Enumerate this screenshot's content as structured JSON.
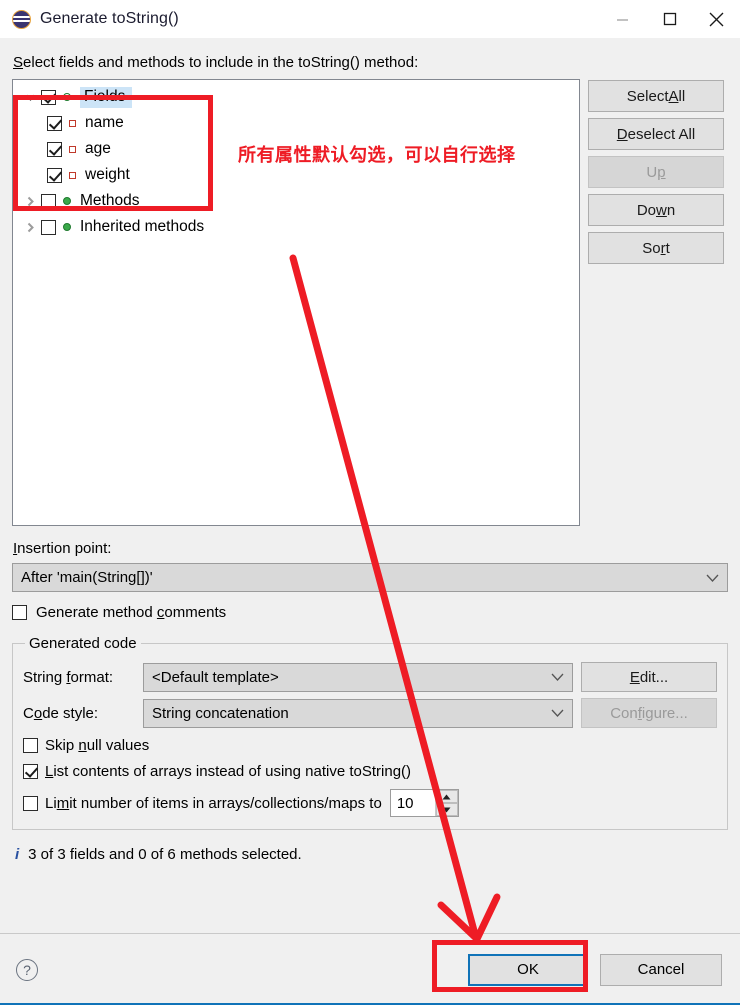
{
  "window": {
    "title": "Generate toString()",
    "icon": "eclipse-java-icon",
    "controls": {
      "minimize": "minimize-icon",
      "maximize": "maximize-icon",
      "close": "close-icon"
    }
  },
  "header": {
    "instruction_prefix": "S",
    "instruction": "elect fields and methods to include in the toString() method:"
  },
  "tree": {
    "nodes": [
      {
        "label": "Fields",
        "checked": true,
        "expanded": true,
        "selected": true,
        "icon": "green-circle-icon",
        "level": 0
      },
      {
        "label": "name",
        "checked": true,
        "icon": "red-square-icon",
        "level": 1
      },
      {
        "label": "age",
        "checked": true,
        "icon": "red-square-icon",
        "level": 1
      },
      {
        "label": "weight",
        "checked": true,
        "icon": "red-square-icon",
        "level": 1
      },
      {
        "label": "Methods",
        "checked": false,
        "expanded": false,
        "icon": "green-circle-icon",
        "level": 0
      },
      {
        "label": "Inherited methods",
        "checked": false,
        "expanded": false,
        "icon": "green-circle-icon",
        "level": 0
      }
    ]
  },
  "side_buttons": [
    {
      "pre": "Select ",
      "mn": "A",
      "post": "ll",
      "name": "select-all-button",
      "disabled": false
    },
    {
      "pre": "",
      "mn": "D",
      "post": "eselect All",
      "name": "deselect-all-button",
      "disabled": false
    },
    {
      "pre": "U",
      "mn": "p",
      "post": "",
      "name": "up-button",
      "disabled": true
    },
    {
      "pre": "Do",
      "mn": "w",
      "post": "n",
      "name": "down-button",
      "disabled": false
    },
    {
      "pre": "So",
      "mn": "r",
      "post": "t",
      "name": "sort-button",
      "disabled": false
    }
  ],
  "insertion_point": {
    "label_mn": "I",
    "label_rest": "nsertion point:",
    "value": "After 'main(String[])'"
  },
  "generate_comments": {
    "label_pre": "Generate method ",
    "label_mn": "c",
    "label_post": "omments",
    "checked": false
  },
  "generated_code": {
    "legend": "Generated code",
    "string_format": {
      "label_pre": "String ",
      "label_mn": "f",
      "label_post": "ormat:",
      "value": "<Default template>",
      "button_pre": "",
      "button_mn": "E",
      "button_post": "dit..."
    },
    "code_style": {
      "label_pre": "C",
      "label_mn": "o",
      "label_post": "de style:",
      "value": "String concatenation",
      "button_pre": "Con",
      "button_mn": "f",
      "button_post": "igure...",
      "button_disabled": true
    },
    "options": [
      {
        "pre": "Skip ",
        "mn": "n",
        "post": "ull values",
        "checked": false,
        "name": "skip-null-values-checkbox"
      },
      {
        "pre": "",
        "mn": "L",
        "post": "ist contents of arrays instead of using native toString()",
        "checked": true,
        "name": "list-array-contents-checkbox"
      },
      {
        "pre": "Li",
        "mn": "m",
        "post": "it number of items in arrays/collections/maps to",
        "checked": false,
        "name": "limit-items-checkbox"
      }
    ],
    "limit_value": "10"
  },
  "status": {
    "icon": "info-icon",
    "text": "3 of 3 fields and 0 of 6 methods selected."
  },
  "footer": {
    "help": "?",
    "ok": "OK",
    "cancel": "Cancel"
  },
  "annotations": {
    "note_text": "所有属性默认勾选，可以自行选择",
    "box_color": "#ee1c25",
    "arrow_color": "#ee1c25"
  }
}
